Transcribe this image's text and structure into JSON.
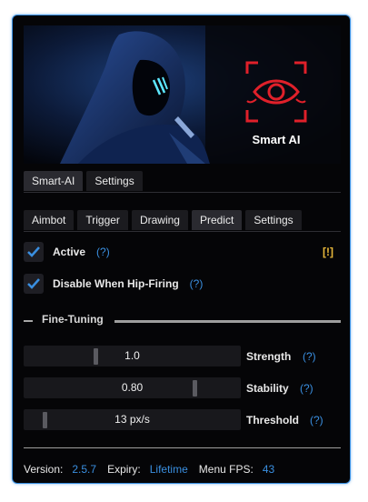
{
  "banner": {
    "logo_text": "Smart AI"
  },
  "top_tabs": [
    "Smart-AI",
    "Settings"
  ],
  "sub_tabs": [
    "Aimbot",
    "Trigger",
    "Drawing",
    "Predict",
    "Settings"
  ],
  "active_top_tab": "Smart-AI",
  "active_sub_tab": "Predict",
  "options": {
    "active": {
      "label": "Active",
      "help": "(?)",
      "checked": true
    },
    "hip": {
      "label": "Disable When Hip-Firing",
      "help": "(?)",
      "checked": true
    },
    "warning": "[!]"
  },
  "section": {
    "title": "Fine-Tuning"
  },
  "sliders": [
    {
      "value": "1.0",
      "label": "Strength",
      "help": "(?)",
      "level": 0.31
    },
    {
      "value": "0.80",
      "label": "Stability",
      "help": "(?)",
      "level": 0.8
    },
    {
      "value": "13 px/s",
      "label": "Threshold",
      "help": "(?)",
      "level": 0.06
    }
  ],
  "footer": {
    "version_label": "Version:",
    "version": "2.5.7",
    "expiry_label": "Expiry:",
    "expiry": "Lifetime",
    "fps_label": "Menu FPS:",
    "fps": "43"
  },
  "colors": {
    "accent": "#3a8fe0",
    "warning": "#e8b83a",
    "logo_red": "#e0202a"
  }
}
